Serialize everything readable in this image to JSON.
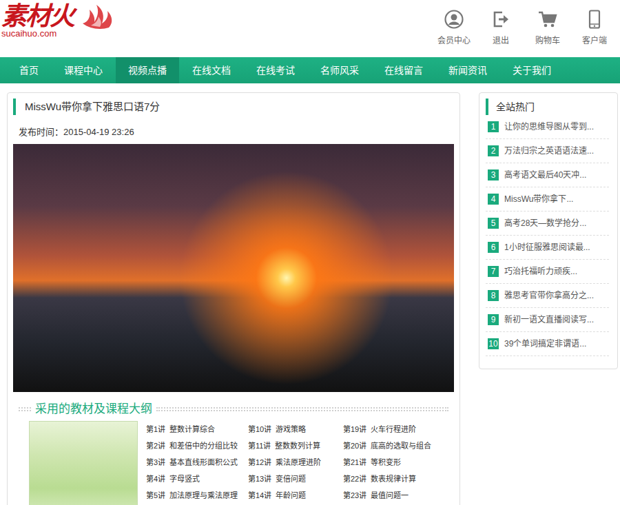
{
  "logo": {
    "name": "素材火",
    "domain": "sucaihuo.com"
  },
  "header_links": [
    {
      "label": "会员中心"
    },
    {
      "label": "退出"
    },
    {
      "label": "购物车"
    },
    {
      "label": "客户端"
    }
  ],
  "nav": [
    {
      "label": "首页",
      "selected": false
    },
    {
      "label": "课程中心",
      "selected": false
    },
    {
      "label": "视频点播",
      "selected": true
    },
    {
      "label": "在线文档",
      "selected": false
    },
    {
      "label": "在线考试",
      "selected": false
    },
    {
      "label": "名师风采",
      "selected": false
    },
    {
      "label": "在线留言",
      "selected": false
    },
    {
      "label": "新闻资讯",
      "selected": false
    },
    {
      "label": "关于我们",
      "selected": false
    }
  ],
  "article": {
    "title": "MissWu带你拿下雅思口语7分",
    "published": "发布时间：2015-04-19 23:26"
  },
  "syllabus": {
    "heading": "采用的教材及课程大纲",
    "columns": [
      [
        {
          "no": "第1讲",
          "title": "整数计算综合"
        },
        {
          "no": "第2讲",
          "title": "和差倍中的分组比较"
        },
        {
          "no": "第3讲",
          "title": "基本直线形面积公式"
        },
        {
          "no": "第4讲",
          "title": "字母竖式"
        },
        {
          "no": "第5讲",
          "title": "加法原理与乘法原理"
        }
      ],
      [
        {
          "no": "第10讲",
          "title": "游戏策略"
        },
        {
          "no": "第11讲",
          "title": "整数数列计算"
        },
        {
          "no": "第12讲",
          "title": "乘法原理进阶"
        },
        {
          "no": "第13讲",
          "title": "变倍问题"
        },
        {
          "no": "第14讲",
          "title": "年龄问题"
        }
      ],
      [
        {
          "no": "第19讲",
          "title": "火车行程进阶"
        },
        {
          "no": "第20讲",
          "title": "底高的选取与组合"
        },
        {
          "no": "第21讲",
          "title": "等积变形"
        },
        {
          "no": "第22讲",
          "title": "数表规律计算"
        },
        {
          "no": "第23讲",
          "title": "最值问题一"
        }
      ]
    ]
  },
  "sidebar": {
    "title": "全站热门",
    "items": [
      {
        "rank": "1",
        "title": "让你的思维导图从零到..."
      },
      {
        "rank": "2",
        "title": "万法归宗之英语语法速..."
      },
      {
        "rank": "3",
        "title": "高考语文最后40天冲..."
      },
      {
        "rank": "4",
        "title": "MissWu带你拿下..."
      },
      {
        "rank": "5",
        "title": "高考28天—数学抢分..."
      },
      {
        "rank": "6",
        "title": "1小时征服雅思阅读最..."
      },
      {
        "rank": "7",
        "title": "巧治托福听力顽疾..."
      },
      {
        "rank": "8",
        "title": "雅思考官带你拿高分之..."
      },
      {
        "rank": "9",
        "title": "新初一语文直播阅读写..."
      },
      {
        "rank": "10",
        "title": "39个单词搞定非谓语..."
      }
    ]
  }
}
